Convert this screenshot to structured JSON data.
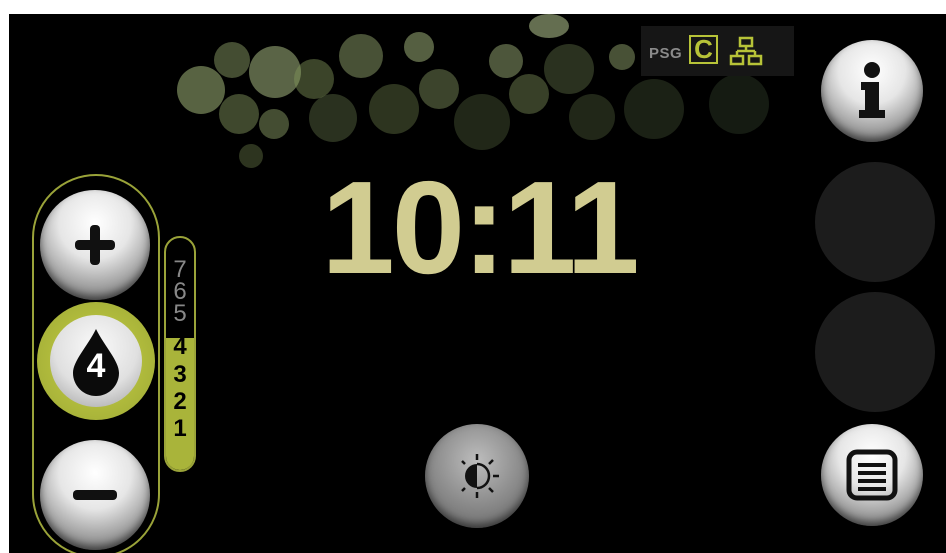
{
  "status": {
    "psg_label": "PSG",
    "mode_letter": "C",
    "network_icon": "network-icon"
  },
  "clock": {
    "time": "10:11"
  },
  "intensity": {
    "current_level": "4",
    "scale_labels": [
      "7",
      "6",
      "5",
      "4",
      "3",
      "2",
      "1"
    ],
    "max_level": 7,
    "selected_level": 4
  },
  "buttons": {
    "info_icon": "info-icon",
    "menu_icon": "menu-icon",
    "brightness_icon": "brightness-icon",
    "plus_icon": "plus-icon",
    "minus_icon": "minus-icon"
  },
  "colors": {
    "accent": "#a9b43a",
    "clock": "#d1cc91",
    "background": "#000000"
  }
}
